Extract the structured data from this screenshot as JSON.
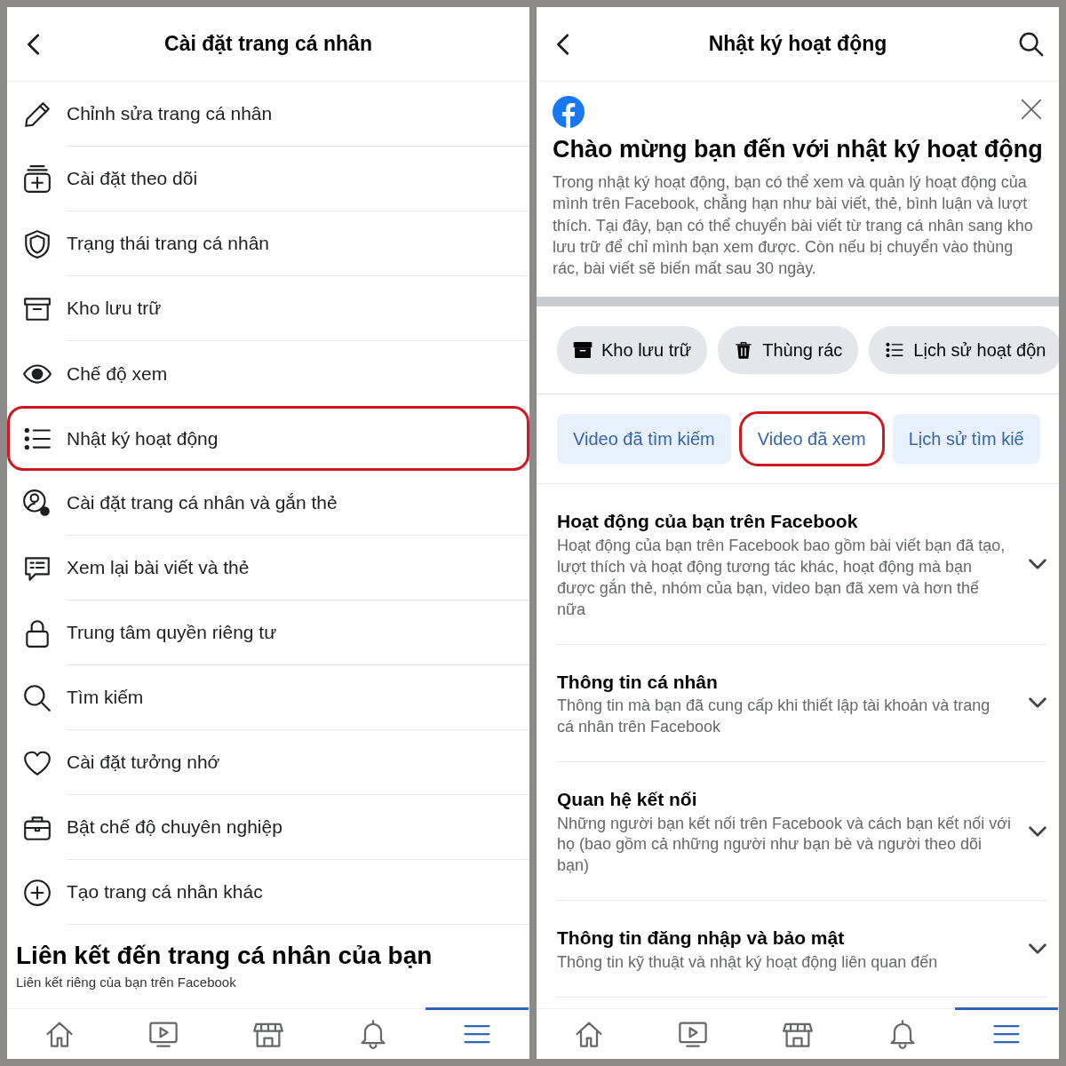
{
  "left_screen": {
    "header": {
      "title": "Cài đặt trang cá nhân"
    },
    "menu_items": [
      {
        "label": "Chỉnh sửa trang cá nhân",
        "highlighted": false
      },
      {
        "label": "Cài đặt theo dõi",
        "highlighted": false
      },
      {
        "label": "Trạng thái trang cá nhân",
        "highlighted": false
      },
      {
        "label": "Kho lưu trữ",
        "highlighted": false
      },
      {
        "label": "Chế độ xem",
        "highlighted": false
      },
      {
        "label": "Nhật ký hoạt động",
        "highlighted": true
      },
      {
        "label": "Cài đặt trang cá nhân và gắn thẻ",
        "highlighted": false
      },
      {
        "label": "Xem lại bài viết và thẻ",
        "highlighted": false
      },
      {
        "label": "Trung tâm quyền riêng tư",
        "highlighted": false
      },
      {
        "label": "Tìm kiếm",
        "highlighted": false
      },
      {
        "label": "Cài đặt tưởng nhớ",
        "highlighted": false
      },
      {
        "label": "Bật chế độ chuyên nghiệp",
        "highlighted": false
      },
      {
        "label": "Tạo trang cá nhân khác",
        "highlighted": false
      }
    ],
    "section": {
      "title": "Liên kết đến trang cá nhân của bạn",
      "subtitle": "Liên kết riêng của bạn trên Facebook"
    },
    "bottom_nav": [
      {
        "selected": false
      },
      {
        "selected": false
      },
      {
        "selected": false
      },
      {
        "selected": false
      },
      {
        "selected": true
      }
    ]
  },
  "right_screen": {
    "header": {
      "title": "Nhật ký hoạt động"
    },
    "welcome": {
      "title": "Chào mừng bạn đến với nhật ký hoạt động",
      "text": "Trong nhật ký hoạt động, bạn có thể xem và quản lý hoạt động của mình trên Facebook, chẳng hạn như bài viết, thẻ, bình luận và lượt thích. Tại đây, bạn có thể chuyển bài viết từ trang cá nhân sang kho lưu trữ để chỉ mình bạn xem được. Còn nếu bị chuyển vào thùng rác, bài viết sẽ biến mất sau 30 ngày."
    },
    "action_chips": [
      {
        "label": "Kho lưu trữ"
      },
      {
        "label": "Thùng rác"
      },
      {
        "label": "Lịch sử hoạt độn"
      }
    ],
    "filter_chips": [
      {
        "label": "Video đã tìm kiếm",
        "highlighted": false
      },
      {
        "label": "Video đã xem",
        "highlighted": true
      },
      {
        "label": "Lịch sử tìm kiế",
        "highlighted": false
      }
    ],
    "categories": [
      {
        "title": "Hoạt động của bạn trên Facebook",
        "description": "Hoạt động của bạn trên Facebook bao gồm bài viết bạn đã tạo, lượt thích và hoạt động tương tác khác, hoạt động mà bạn được gắn thẻ, nhóm của bạn, video bạn đã xem và hơn thế nữa"
      },
      {
        "title": "Thông tin cá nhân",
        "description": "Thông tin mà bạn đã cung cấp khi thiết lập tài khoản và trang cá nhân trên Facebook"
      },
      {
        "title": "Quan hệ kết nối",
        "description": "Những người bạn kết nối trên Facebook và cách bạn kết nối với họ (bao gồm cả những người như bạn bè và người theo dõi bạn)"
      },
      {
        "title": "Thông tin đăng nhập và bảo mật",
        "description": "Thông tin kỹ thuật và nhật ký hoạt động liên quan đến"
      }
    ],
    "bottom_nav": [
      {
        "selected": false
      },
      {
        "selected": false
      },
      {
        "selected": false
      },
      {
        "selected": false
      },
      {
        "selected": true
      }
    ]
  }
}
